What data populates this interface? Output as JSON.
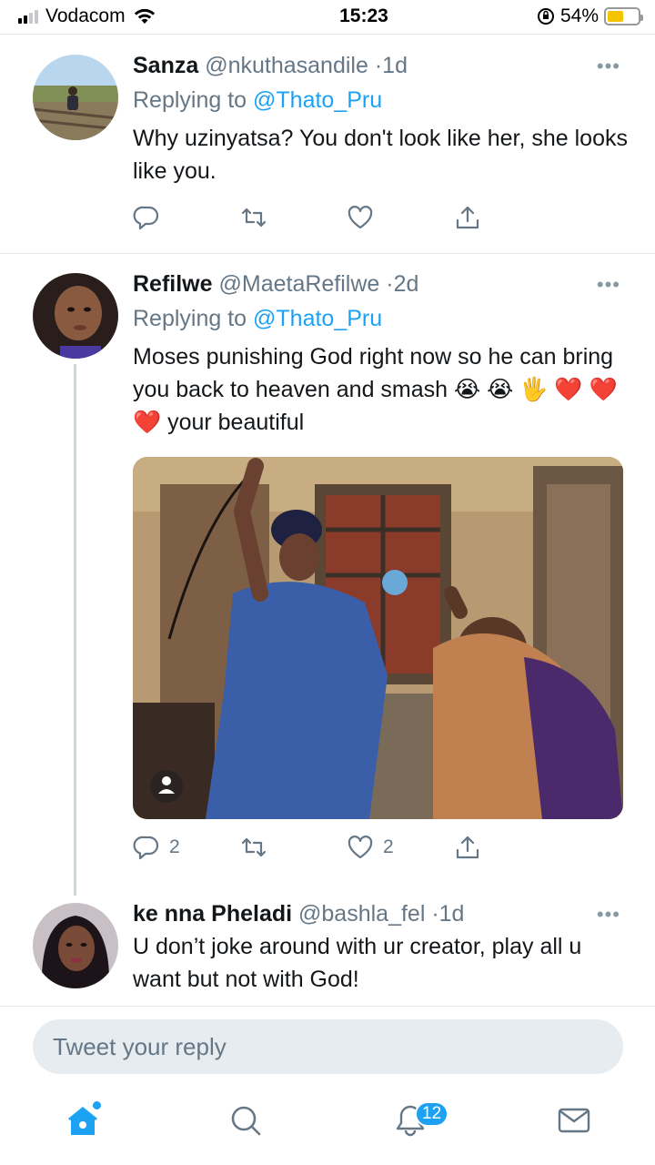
{
  "status_bar": {
    "carrier": "Vodacom",
    "time": "15:23",
    "battery_percent": "54%",
    "battery_level": 0.54,
    "signal_bars": 2
  },
  "tweets": [
    {
      "display_name": "Sanza",
      "handle": "@nkuthasandile",
      "separator": "·",
      "time": "1d",
      "replying_prefix": "Replying to",
      "replying_to": "@Thato_Pru",
      "text": "Why uzinyatsa? You don't look like her, she looks like you.",
      "more": "•••",
      "reply_count": "",
      "retweet_count": "",
      "like_count": ""
    },
    {
      "display_name": "Refilwe",
      "handle": "@MaetaRefilwe",
      "separator": "·",
      "time": "2d",
      "replying_prefix": "Replying to",
      "replying_to": "@Thato_Pru",
      "text": "Moses punishing God right now so he can bring you back to heaven and smash 😭 😭 🖐 ❤️ ❤️ ❤️ your beautiful",
      "more": "•••",
      "reply_count": "2",
      "retweet_count": "",
      "like_count": "2"
    },
    {
      "display_name": "ke nna Pheladi",
      "handle": "@bashla_fel",
      "separator": "·",
      "time": "1d",
      "text": "U don’t joke around with ur creator, play all u want but not with God!",
      "more": "•••"
    }
  ],
  "reply_box": {
    "placeholder": "Tweet your reply"
  },
  "tab_bar": {
    "items": [
      "home-icon",
      "search-icon",
      "notifications-icon",
      "messages-icon"
    ],
    "notification_badge": "12"
  },
  "colors": {
    "accent": "#1da1f2",
    "muted": "#657786",
    "divider": "#e1e8ed"
  }
}
